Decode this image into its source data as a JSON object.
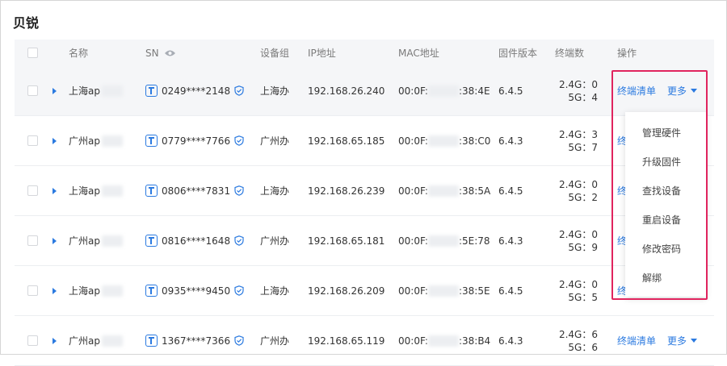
{
  "page": {
    "title": "贝锐"
  },
  "table": {
    "headers": {
      "name": "名称",
      "sn": "SN",
      "group": "设备组",
      "ip": "IP地址",
      "mac": "MAC地址",
      "firmware": "固件版本",
      "terminals": "终端数",
      "actions": "操作"
    },
    "rows": [
      {
        "name": "上海ap",
        "sn": "0249****2148",
        "group": "上海办",
        "ip": "192.168.26.240",
        "mac_prefix": "00:0F:",
        "mac_suffix": ":38:4E",
        "firmware": "6.4.5",
        "t24": "2.4G：0",
        "t5": "5G：4"
      },
      {
        "name": "广州ap",
        "sn": "0779****7766",
        "group": "广州办",
        "ip": "192.168.65.185",
        "mac_prefix": "00:0F:",
        "mac_suffix": ":38:C0",
        "firmware": "6.4.3",
        "t24": "2.4G：3",
        "t5": "5G：7"
      },
      {
        "name": "上海ap",
        "sn": "0806****7831",
        "group": "上海办",
        "ip": "192.168.26.239",
        "mac_prefix": "00:0F:",
        "mac_suffix": ":38:5A",
        "firmware": "6.4.5",
        "t24": "2.4G：0",
        "t5": "5G：2"
      },
      {
        "name": "广州ap",
        "sn": "0816****1648",
        "group": "广州办",
        "ip": "192.168.65.181",
        "mac_prefix": "00:0F:",
        "mac_suffix": ":5E:78",
        "firmware": "6.4.3",
        "t24": "2.4G：0",
        "t5": "5G：9"
      },
      {
        "name": "上海ap",
        "sn": "0935****9450",
        "group": "上海办",
        "ip": "192.168.26.209",
        "mac_prefix": "00:0F:",
        "mac_suffix": ":38:5E",
        "firmware": "6.4.5",
        "t24": "2.4G：0",
        "t5": "5G：5"
      },
      {
        "name": "广州ap",
        "sn": "1367****7366",
        "group": "广州办",
        "ip": "192.168.65.119",
        "mac_prefix": "00:0F:",
        "mac_suffix": ":38:B4",
        "firmware": "6.4.3",
        "t24": "2.4G：6",
        "t5": "5G：6"
      }
    ],
    "actions": {
      "terminal_list": "终端清单",
      "terminal_list_clipped": "终",
      "more": "更多"
    }
  },
  "dropdown": {
    "items": [
      "管理硬件",
      "升级固件",
      "查找设备",
      "重启设备",
      "修改密码",
      "解绑"
    ]
  },
  "colors": {
    "accent": "#2b7ae0",
    "highlight": "#e0245e"
  }
}
